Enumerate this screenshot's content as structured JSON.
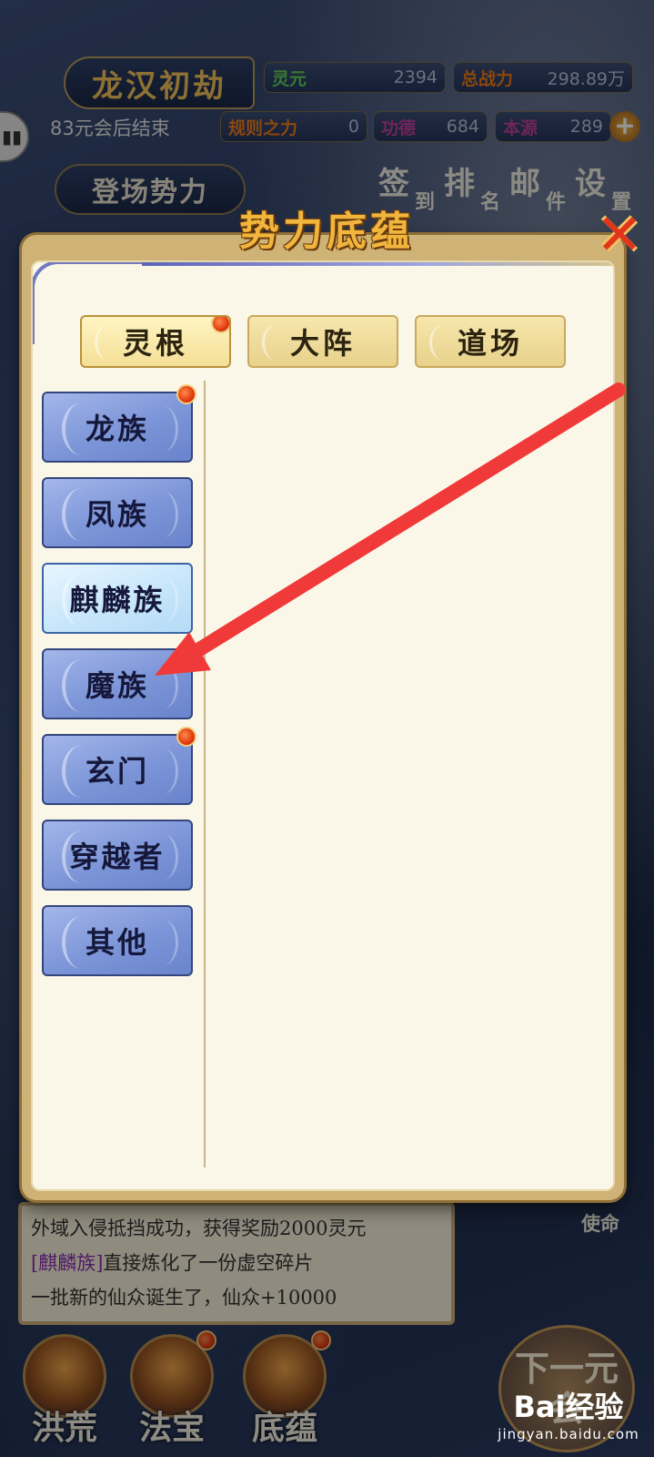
{
  "hud": {
    "title": "龙汉初劫",
    "countdown": "83元会后结束",
    "faction_button": "登场势力",
    "stats": [
      {
        "label": "灵元",
        "value": "2394",
        "color": "#5fd05a"
      },
      {
        "label": "总战力",
        "value": "298.89万",
        "color": "#f07a1a"
      },
      {
        "label": "规则之力",
        "value": "0",
        "color": "#f07a1a"
      },
      {
        "label": "功德",
        "value": "684",
        "color": "#c0409c"
      },
      {
        "label": "本源",
        "value": "289",
        "color": "#c0409c"
      }
    ],
    "menu": [
      {
        "big": "签",
        "small": "到"
      },
      {
        "big": "排",
        "small": "名"
      },
      {
        "big": "邮",
        "small": "件"
      },
      {
        "big": "设",
        "small": "置"
      }
    ]
  },
  "modal": {
    "title": "势力底蕴",
    "close_icon": "close-x-icon",
    "tabs": [
      {
        "label": "灵根",
        "active": true,
        "badge": true
      },
      {
        "label": "大阵",
        "active": false,
        "badge": false
      },
      {
        "label": "道场",
        "active": false,
        "badge": false
      }
    ],
    "categories": [
      {
        "label": "龙族",
        "selected": false,
        "badge": true
      },
      {
        "label": "凤族",
        "selected": false,
        "badge": false
      },
      {
        "label": "麒麟族",
        "selected": true,
        "badge": false
      },
      {
        "label": "魔族",
        "selected": false,
        "badge": true
      },
      {
        "label": "玄门",
        "selected": false,
        "badge": true
      },
      {
        "label": "穿越者",
        "selected": false,
        "badge": false
      },
      {
        "label": "其他",
        "selected": false,
        "badge": false
      }
    ]
  },
  "log": {
    "lines": [
      {
        "prefix": "",
        "text": "外域入侵抵挡成功，获得奖励2000灵元"
      },
      {
        "prefix": "[麒麟族]",
        "text": "直接炼化了一份虚空碎片"
      },
      {
        "prefix": "",
        "text": "一批新的仙众诞生了，仙众+10000"
      }
    ],
    "mission_button": "使命"
  },
  "bottom_nav": [
    {
      "label": "洪荒",
      "badge": false
    },
    {
      "label": "法宝",
      "badge": true
    },
    {
      "label": "底蕴",
      "badge": true
    }
  ],
  "next_round": "下一元会",
  "watermark": {
    "brand": "Bai经验",
    "domain": "jingyan.baidu.com"
  },
  "annotation": {
    "color": "#f03a3a"
  }
}
